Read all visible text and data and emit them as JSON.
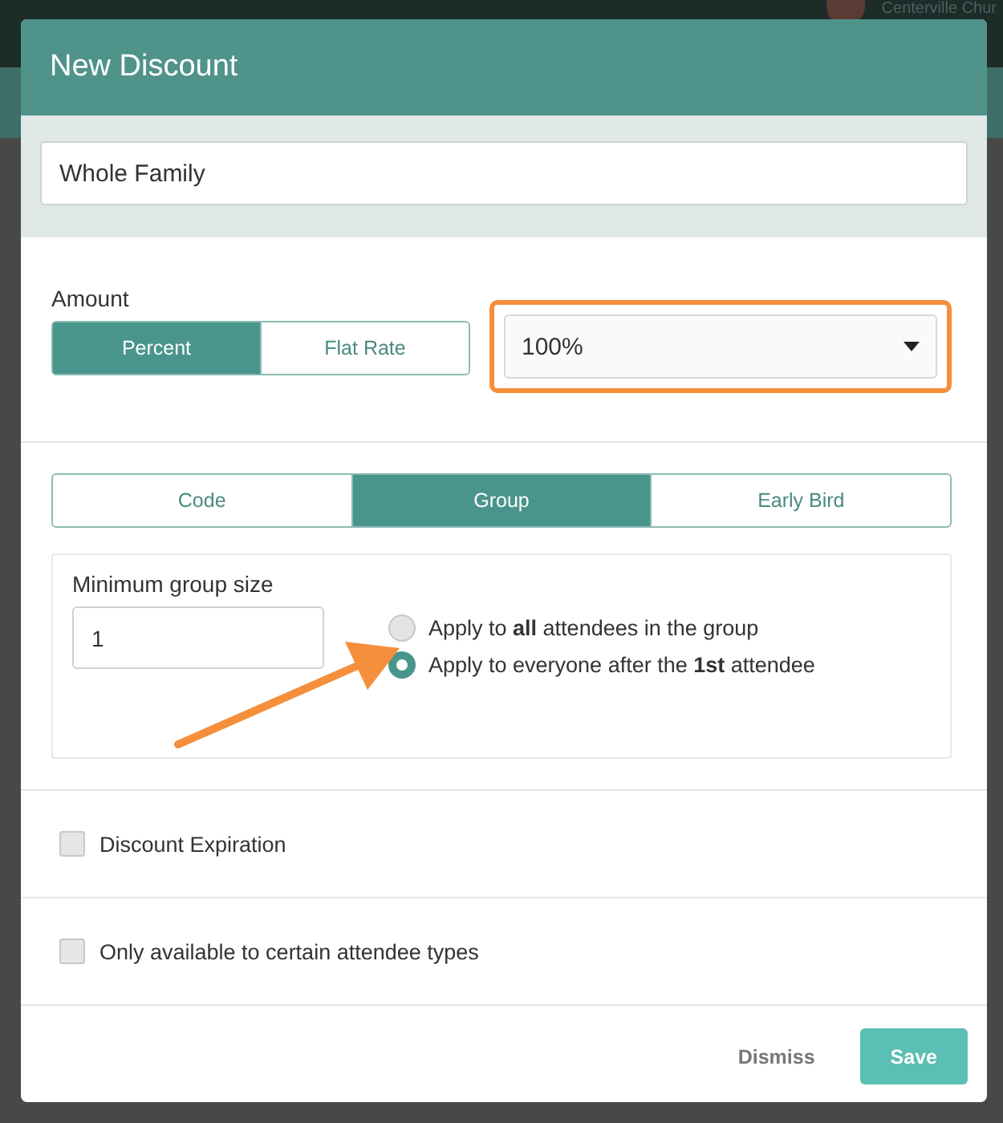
{
  "background": {
    "account_name": "Centerville Chur"
  },
  "dialog": {
    "title": "New Discount",
    "name_field": {
      "value": "Whole Family"
    },
    "amount": {
      "label": "Amount",
      "types": [
        {
          "label": "Percent",
          "selected": true
        },
        {
          "label": "Flat Rate",
          "selected": false
        }
      ],
      "dropdown": {
        "value": "100%",
        "highlighted": true
      }
    },
    "rule_tabs": [
      {
        "label": "Code",
        "selected": false
      },
      {
        "label": "Group",
        "selected": true
      },
      {
        "label": "Early Bird",
        "selected": false
      }
    ],
    "group": {
      "min_label": "Minimum group size",
      "min_value": "1",
      "pointer_arrow": true,
      "options": [
        {
          "label": "Apply to **all** attendees in the group",
          "selected": false
        },
        {
          "label": "Apply to everyone after the **1st** attendee",
          "selected": true
        }
      ]
    },
    "checkboxes": [
      {
        "label": "Discount Expiration",
        "checked": false
      },
      {
        "label": "Only available to certain attendee types",
        "checked": false
      }
    ],
    "buttons": [
      {
        "label": "Dismiss",
        "kind": "link"
      },
      {
        "label": "Save",
        "kind": "primary"
      }
    ]
  }
}
